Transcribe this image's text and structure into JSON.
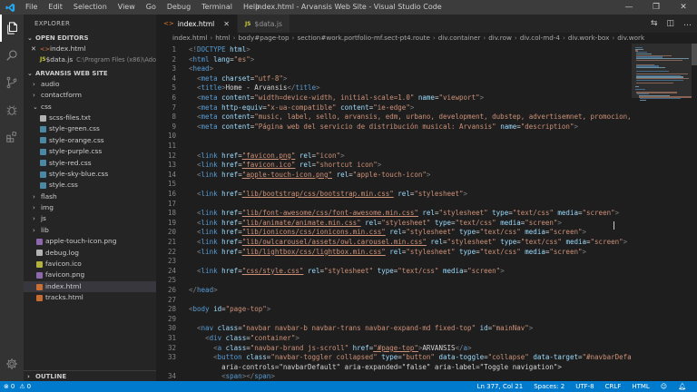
{
  "window": {
    "title": "index.html - Arvansis Web Site - Visual Studio Code",
    "menu": [
      "File",
      "Edit",
      "Selection",
      "View",
      "Go",
      "Debug",
      "Terminal",
      "Help"
    ],
    "controls": [
      "—",
      "❐",
      "✕"
    ]
  },
  "explorer": {
    "title": "EXPLORER",
    "open_editors_label": "OPEN EDITORS",
    "open_editors": [
      {
        "name": "index.html",
        "close": "✕",
        "icon": "html-file-icon"
      },
      {
        "name": "$data.js",
        "path": "C:\\Program Files (x86)\\Ado...",
        "icon": "js-file-icon"
      }
    ],
    "project_label": "ARVANSIS WEB SITE",
    "tree": [
      {
        "name": "audio",
        "type": "folder",
        "depth": 1,
        "expanded": false
      },
      {
        "name": "contactform",
        "type": "folder",
        "depth": 1,
        "expanded": false
      },
      {
        "name": "css",
        "type": "folder",
        "depth": 1,
        "expanded": true
      },
      {
        "name": "scss-files.txt",
        "type": "file",
        "depth": 2,
        "color": "#cccccc"
      },
      {
        "name": "style-green.css",
        "type": "file",
        "depth": 2,
        "color": "#519aba"
      },
      {
        "name": "style-orange.css",
        "type": "file",
        "depth": 2,
        "color": "#519aba"
      },
      {
        "name": "style-purple.css",
        "type": "file",
        "depth": 2,
        "color": "#519aba"
      },
      {
        "name": "style-red.css",
        "type": "file",
        "depth": 2,
        "color": "#519aba"
      },
      {
        "name": "style-sky-blue.css",
        "type": "file",
        "depth": 2,
        "color": "#519aba"
      },
      {
        "name": "style.css",
        "type": "file",
        "depth": 2,
        "color": "#519aba"
      },
      {
        "name": "flash",
        "type": "folder",
        "depth": 1,
        "expanded": false
      },
      {
        "name": "img",
        "type": "folder",
        "depth": 1,
        "expanded": false
      },
      {
        "name": "js",
        "type": "folder",
        "depth": 1,
        "expanded": false
      },
      {
        "name": "lib",
        "type": "folder",
        "depth": 1,
        "expanded": false
      },
      {
        "name": "apple-touch-icon.png",
        "type": "file",
        "depth": 1,
        "color": "#a074c4"
      },
      {
        "name": "debug.log",
        "type": "file",
        "depth": 1,
        "color": "#cccccc"
      },
      {
        "name": "favicon.ico",
        "type": "file",
        "depth": 1,
        "color": "#cbcb41"
      },
      {
        "name": "favicon.png",
        "type": "file",
        "depth": 1,
        "color": "#a074c4"
      },
      {
        "name": "index.html",
        "type": "file",
        "depth": 1,
        "color": "#e37933",
        "selected": true
      },
      {
        "name": "tracks.html",
        "type": "file",
        "depth": 1,
        "color": "#e37933"
      }
    ],
    "outline_label": "OUTLINE"
  },
  "tabs": [
    {
      "label": "index.html",
      "active": true,
      "icon": "<>",
      "close": "✕"
    },
    {
      "label": "$data.js",
      "active": false,
      "icon": "JS"
    }
  ],
  "tab_actions": [
    "⇆",
    "◫",
    "…"
  ],
  "breadcrumbs": [
    "index.html",
    "html",
    "body#page-top",
    "section#work.portfolio-mf.sect-pt4.route",
    "div.container",
    "div.row",
    "div.col-md-4",
    "div.work-box",
    "div.work"
  ],
  "code_lines": [
    {
      "n": "1",
      "text": "<!DOCTYPE html>"
    },
    {
      "n": "2",
      "text": "<html lang=\"es\">"
    },
    {
      "n": "3",
      "text": "<head>"
    },
    {
      "n": "4",
      "text": "  <meta charset=\"utf-8\">"
    },
    {
      "n": "5",
      "text": "  <title>Home - Arvansis</title>"
    },
    {
      "n": "6",
      "text": "  <meta content=\"width=device-width, initial-scale=1.0\" name=\"viewport\">"
    },
    {
      "n": "7",
      "text": "  <meta http-equiv=\"x-ua-compatible\" content=\"ie-edge\">"
    },
    {
      "n": "8",
      "text": "  <meta content=\"music, label, sello, arvansis, edm, urbano, development, dubstep, advertisemnet, promocion, Cub"
    },
    {
      "n": "9",
      "text": "  <meta content=\"Página web del servicio de distribución musical: Arvansis\" name=\"description\">"
    },
    {
      "n": "10",
      "text": ""
    },
    {
      "n": "11",
      "text": ""
    },
    {
      "n": "12",
      "text": "  <link href=\"favicon.png\" rel=\"icon\">"
    },
    {
      "n": "13",
      "text": "  <link href=\"favicon.ico\" rel=\"shortcut icon\">"
    },
    {
      "n": "14",
      "text": "  <link href=\"apple-touch-icon.png\" rel=\"apple-touch-icon\">"
    },
    {
      "n": "15",
      "text": ""
    },
    {
      "n": "16",
      "text": "  <link href=\"lib/bootstrap/css/bootstrap.min.css\" rel=\"stylesheet\">"
    },
    {
      "n": "17",
      "text": ""
    },
    {
      "n": "18",
      "text": "  <link href=\"lib/font-awesome/css/font-awesome.min.css\" rel=\"stylesheet\" type=\"text/css\" media=\"screen\">"
    },
    {
      "n": "19",
      "text": "  <link href=\"lib/animate/animate.min.css\" rel=\"stylesheet\" type=\"text/css\" media=\"screen\">"
    },
    {
      "n": "20",
      "text": "  <link href=\"lib/ionicons/css/ionicons.min.css\" rel=\"stylesheet\" type=\"text/css\" media=\"screen\">"
    },
    {
      "n": "21",
      "text": "  <link href=\"lib/owlcarousel/assets/owl.carousel.min.css\" rel=\"stylesheet\" type=\"text/css\" media=\"screen\">"
    },
    {
      "n": "22",
      "text": "  <link href=\"lib/lightbox/css/lightbox.min.css\" rel=\"stylesheet\" type=\"text/css\" media=\"screen\">"
    },
    {
      "n": "23",
      "text": ""
    },
    {
      "n": "24",
      "text": "  <link href=\"css/style.css\" rel=\"stylesheet\" type=\"text/css\" media=\"screen\">"
    },
    {
      "n": "25",
      "text": ""
    },
    {
      "n": "26",
      "text": "</head>"
    },
    {
      "n": "27",
      "text": ""
    },
    {
      "n": "28",
      "text": "<body id=\"page-top\">"
    },
    {
      "n": "29",
      "text": ""
    },
    {
      "n": "30",
      "text": "  <nav class=\"navbar navbar-b navbar-trans navbar-expand-md fixed-top\" id=\"mainNav\">"
    },
    {
      "n": "31",
      "text": "    <div class=\"container\">"
    },
    {
      "n": "32",
      "text": "      <a class=\"navbar-brand js-scroll\" href=\"#page-top\">ARVANSIS</a>"
    },
    {
      "n": "33",
      "text": "      <button class=\"navbar-toggler collapsed\" type=\"button\" data-toggle=\"collapse\" data-target=\"#navbarDefault\""
    },
    {
      "n": "",
      "text": "        aria-controls=\"navbarDefault\" aria-expanded=\"false\" aria-label=\"Toggle navigation\">"
    },
    {
      "n": "34",
      "text": "        <span></span>"
    }
  ],
  "status": {
    "errors": "0",
    "warnings": "0",
    "position": "Ln 377, Col 21",
    "spaces": "Spaces: 2",
    "encoding": "UTF-8",
    "eol": "CRLF",
    "language": "HTML"
  },
  "colors": {
    "status_bar": "#007acc",
    "tag": "#569cd6",
    "attribute": "#9cdcfe",
    "string": "#ce9178"
  }
}
